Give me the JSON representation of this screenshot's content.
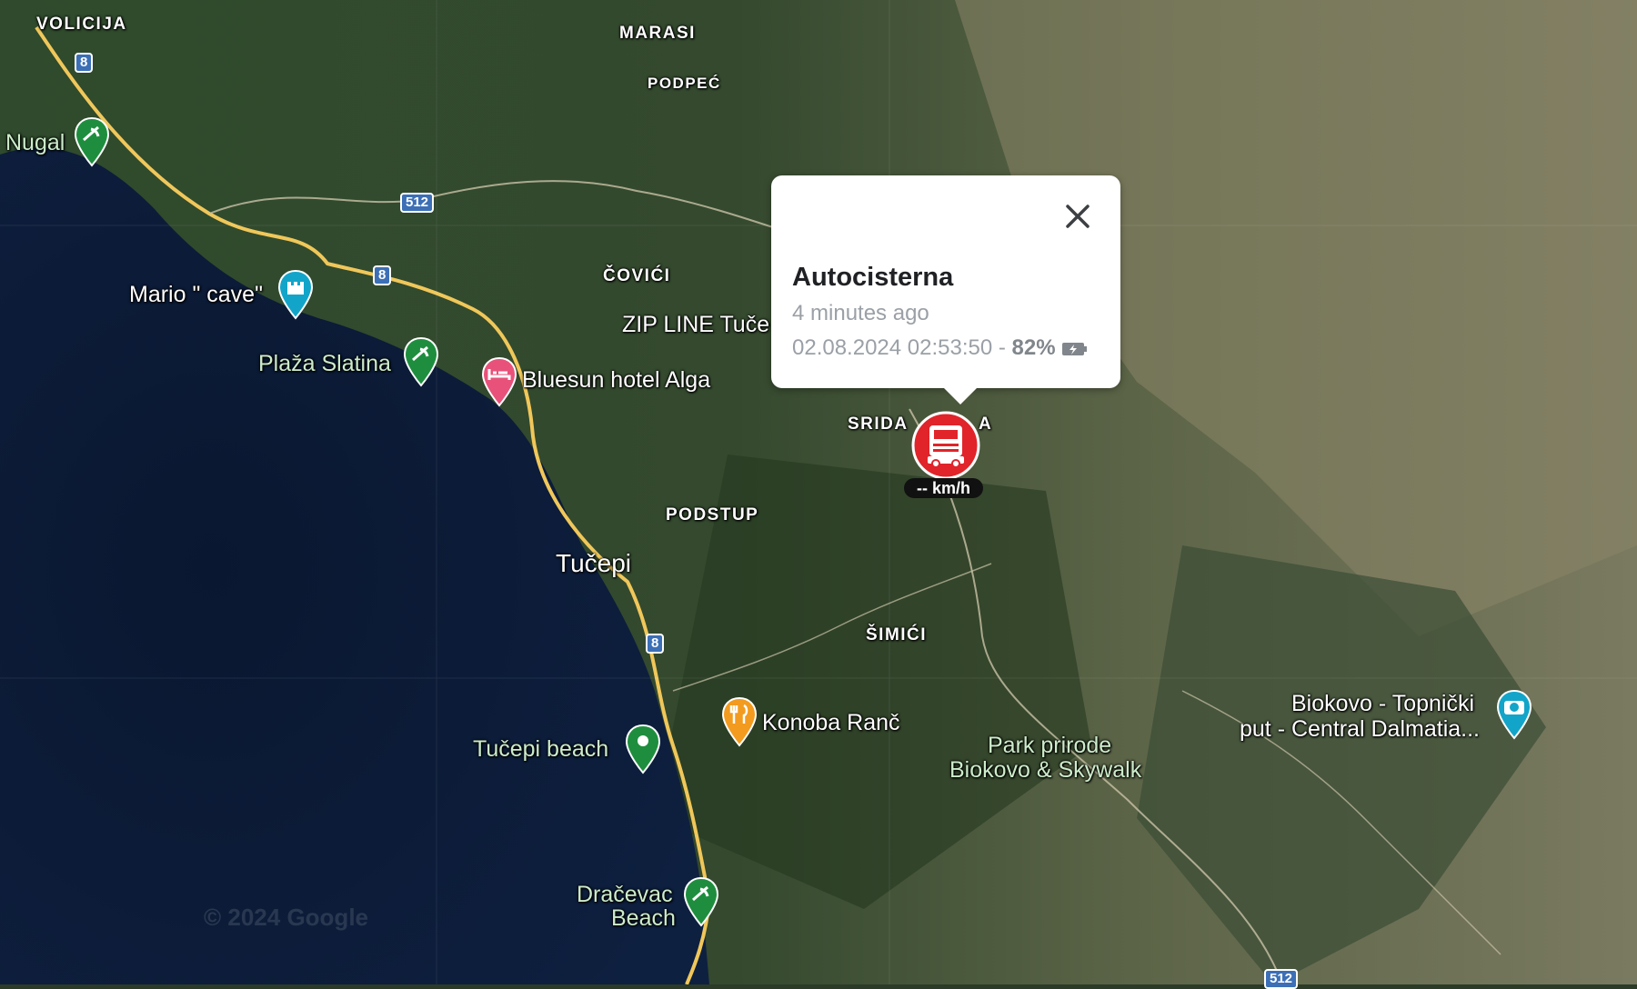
{
  "map": {
    "place_labels": [
      "VOLICIJA",
      "MARASI",
      "PODPEĆ",
      "ČOVIĆI",
      "SRIDA",
      "A",
      "PODSTUP",
      "ŠIMIĆI"
    ],
    "town_label": "Tučepi",
    "poi_labels": {
      "nugal": "Nugal",
      "mario_cave": "Mario \" cave\"",
      "plaza_slatina": "Plaža Slatina",
      "bluesun": "Bluesun hotel Alga",
      "zip_line": "ZIP LINE Tuče",
      "tucepi_beach": "Tučepi beach",
      "konoba": "Konoba Ranč",
      "park_line1": "Park prirode",
      "park_line2": "Biokovo & Skywalk",
      "biokovo_line1": "Biokovo - Topnički",
      "biokovo_line2": "put - Central Dalmatia...",
      "dracevac_line1": "Dračevac",
      "dracevac_line2": "Beach"
    },
    "road_shields": [
      "8",
      "512",
      "8",
      "8",
      "512"
    ],
    "copyright": "© 2024 Google",
    "pin_icons": [
      "beach-icon",
      "castle-icon",
      "beach-icon",
      "hotel-icon",
      "place-icon",
      "restaurant-icon",
      "beach-icon",
      "camera-icon"
    ]
  },
  "popup": {
    "title": "Autocisterna",
    "time_ago": "4 minutes ago",
    "timestamp": "02.08.2024 02:53:50 - ",
    "battery": "82%",
    "close_icon": "close-icon",
    "battery_icon": "battery-charging-icon"
  },
  "vehicle": {
    "speed": "-- km/h",
    "icon": "fire-truck-icon",
    "marker_color": "#e0242a"
  },
  "colors": {
    "sea": "#0c1a33",
    "road": "#f0c75a",
    "poi_green": "#1e8e3e",
    "poi_pink": "#e8527a",
    "poi_orange": "#f29b1f",
    "poi_teal": "#12a5c9"
  }
}
